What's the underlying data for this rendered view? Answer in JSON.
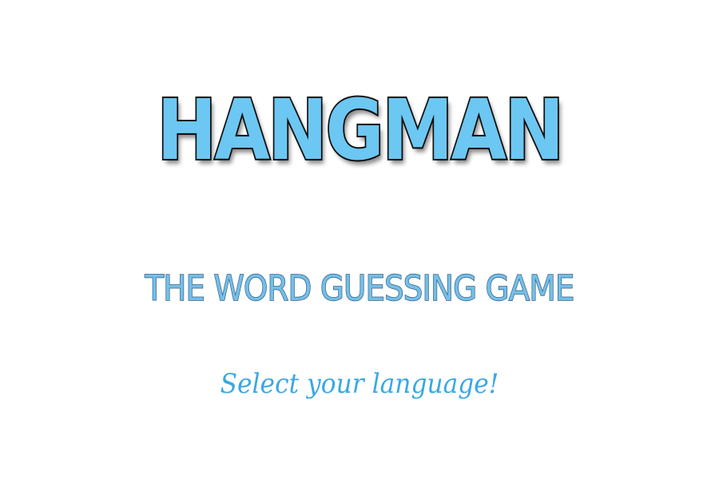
{
  "game": {
    "title": "HANGMAN",
    "subtitle": "THE WORD GUESSING GAME",
    "prompt": "Select your language!"
  },
  "colors": {
    "title_fill": "#6cc7f2",
    "title_outline": "#111111",
    "subtitle_fill": "#74bfe8",
    "subtitle_outline": "#2f5b80",
    "prompt_text": "#3aa8e4",
    "background": "#ffffff"
  }
}
